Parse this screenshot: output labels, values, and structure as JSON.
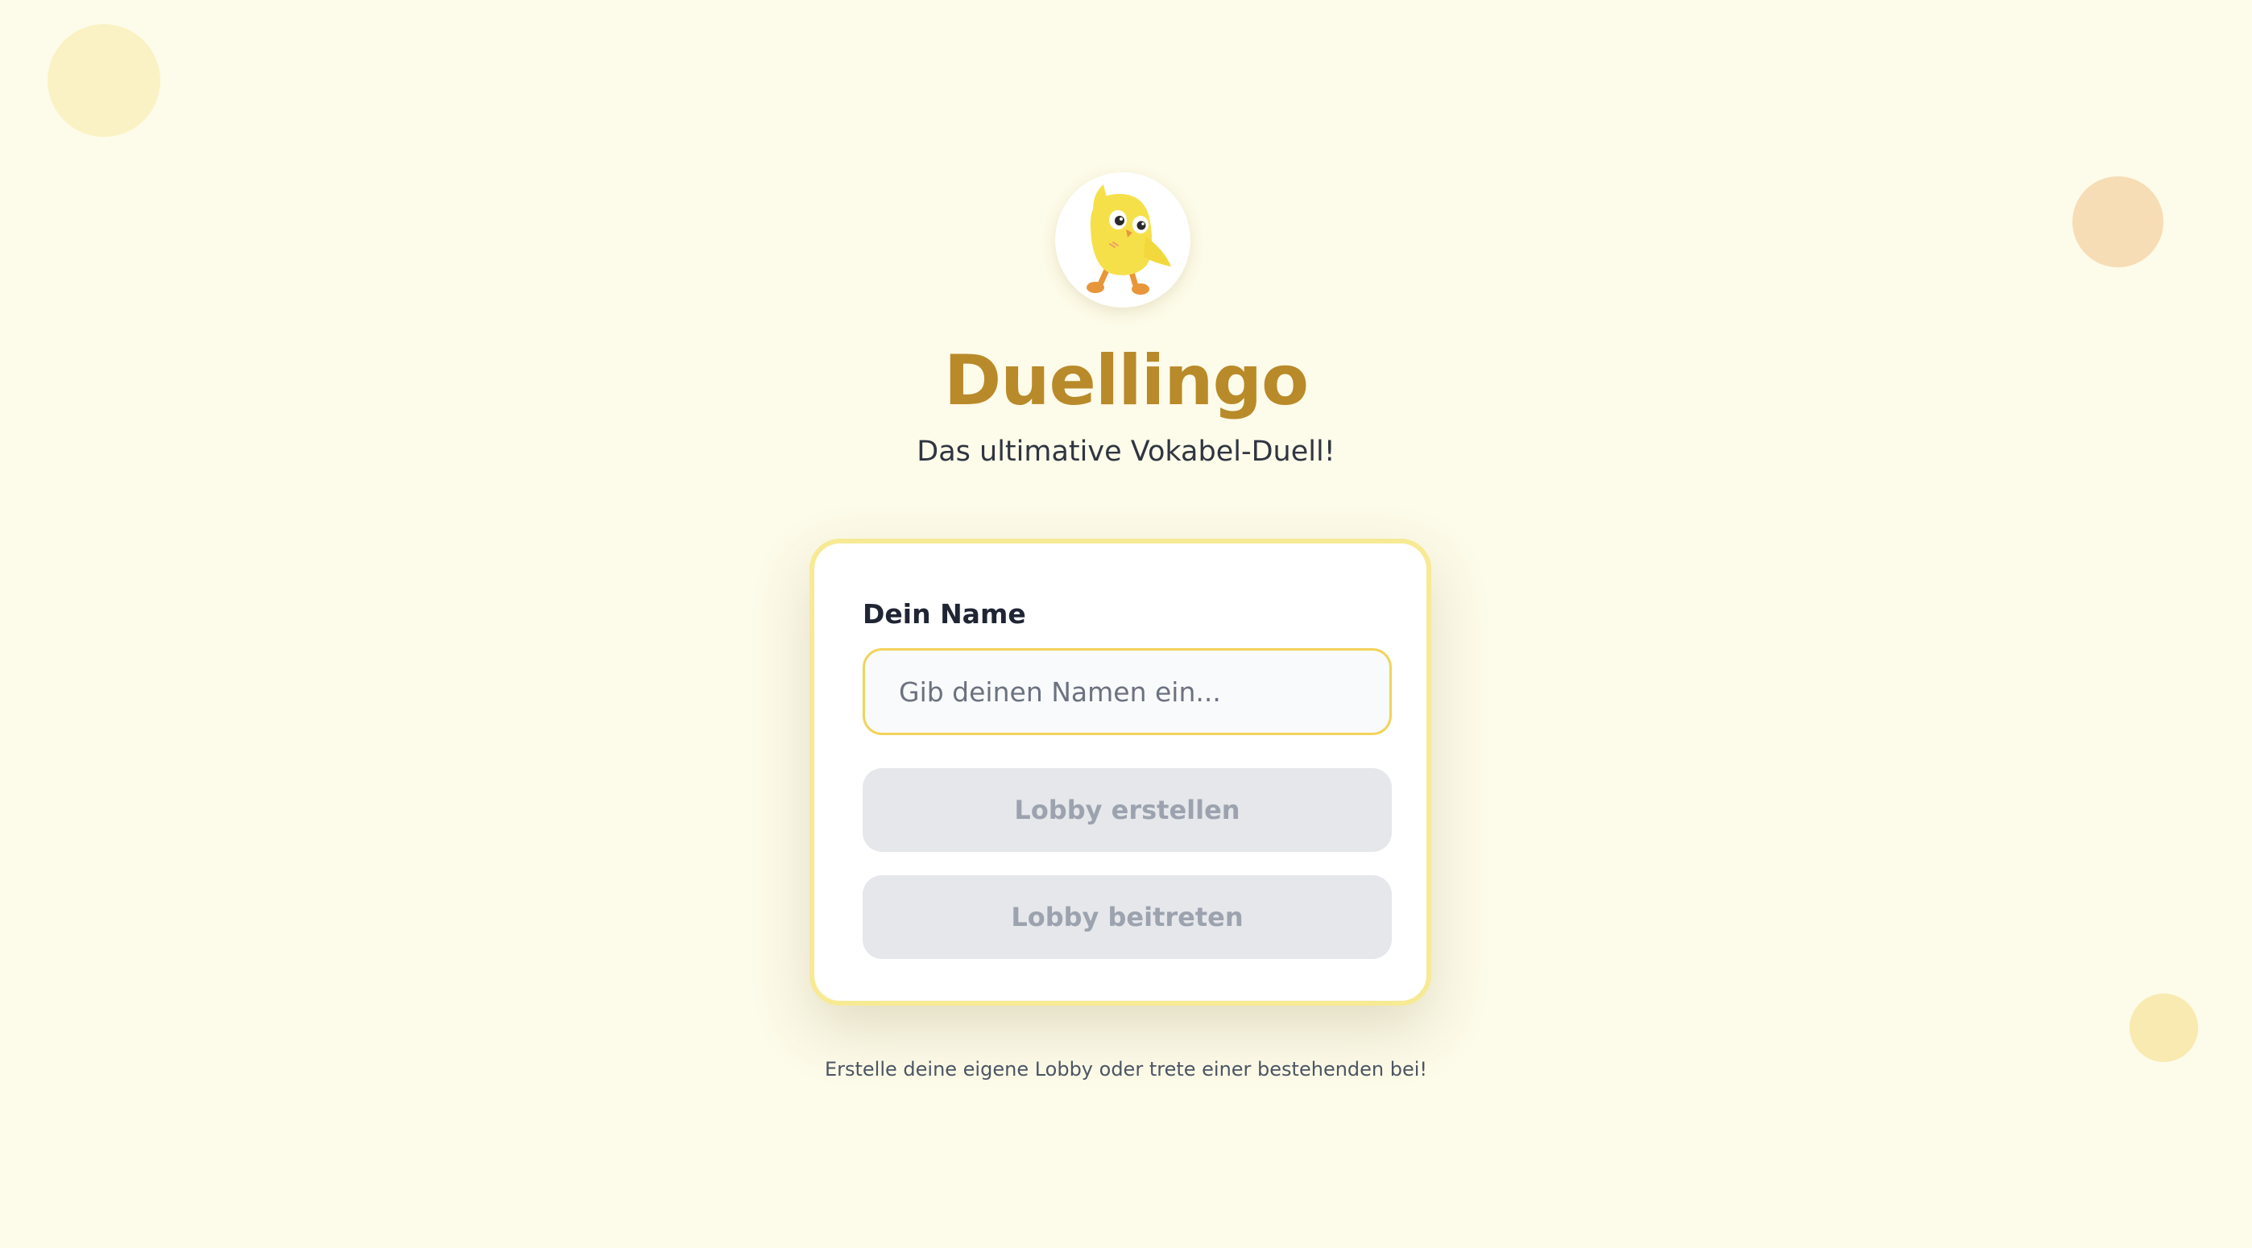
{
  "app": {
    "title": "Duellingo",
    "subtitle": "Das ultimative Vokabel-Duell!",
    "mascot_icon": "yellow-chick-mascot"
  },
  "form": {
    "name_label": "Dein Name",
    "name_value": "",
    "name_placeholder": "Gib deinen Namen ein...",
    "create_button_label": "Lobby erstellen",
    "join_button_label": "Lobby beitreten"
  },
  "footer": {
    "hint": "Erstelle deine eigene Lobby oder trete einer bestehenden bei!"
  },
  "colors": {
    "background": "#fdfbe9",
    "brand": "#b98a2a",
    "card_border": "#f7ea94",
    "input_border": "#f2d35b",
    "button_disabled_bg": "#e5e7eb",
    "button_disabled_text": "#9ca3af"
  }
}
